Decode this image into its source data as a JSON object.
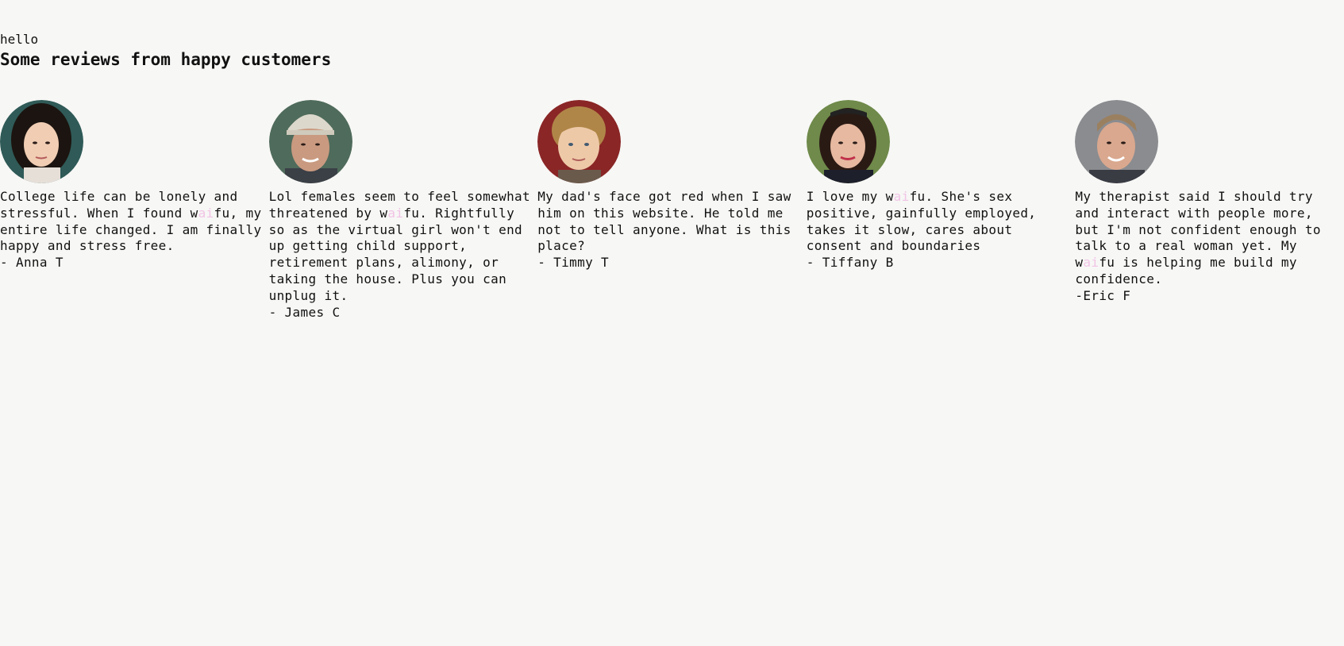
{
  "header": {
    "greeting": "hello",
    "title": "Some reviews from happy customers"
  },
  "reviews": [
    {
      "avatar": "woman-portrait-avatar",
      "pre": "College life can be lonely and\nstressful. When I found w",
      "ai": "ai",
      "post": "fu, my\nentire life changed. I am finally\nhappy and stress free.",
      "author": "- Anna T"
    },
    {
      "avatar": "man-cap-portrait-avatar",
      "pre": "Lol females seem to feel somewhat\nthreatened by w",
      "ai": "ai",
      "post": "fu. Rightfully\nso as the virtual girl won't end\nup getting child support,\nretirement plans, alimony, or\ntaking the house. Plus you can\nunplug it.",
      "author": "- James C"
    },
    {
      "avatar": "boy-portrait-avatar",
      "pre": "My dad's face got red when I saw\nhim on this website. He told me\nnot to tell anyone. What is this\nplace?",
      "ai": "",
      "post": "",
      "author": "- Timmy T"
    },
    {
      "avatar": "woman-sunglasses-portrait-avatar",
      "pre": "I love my w",
      "ai": "ai",
      "post": "fu. She's sex\npositive, gainfully employed,\ntakes it slow, cares about\nconsent and boundaries",
      "author": "- Tiffany B"
    },
    {
      "avatar": "man-portrait-avatar",
      "pre": "My therapist said I should try\nand interact with people more,\nbut I'm not confident enough to\ntalk to a real woman yet. My\nw",
      "ai": "ai",
      "post": "fu is helping me build my\nconfidence.",
      "author": "-Eric F"
    }
  ]
}
